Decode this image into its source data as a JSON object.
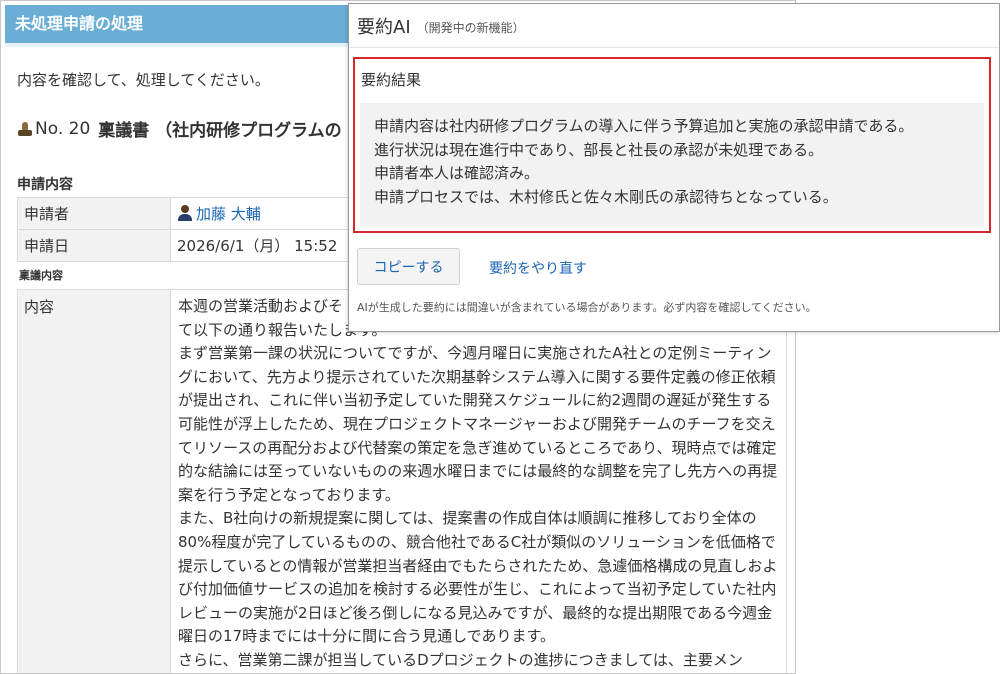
{
  "main": {
    "header_title": "未処理申請の処理",
    "instruction": "内容を確認して、処理してください。",
    "request_number": "No. 20",
    "request_doc": "稟議書 （社内研修プログラムの",
    "section_title": "申請内容",
    "fields": [
      {
        "label": "申請者",
        "value": "加藤 大輔"
      },
      {
        "label": "申請日",
        "value": "2026/6/1（月） 15:52"
      }
    ],
    "ringi_label": "稟議内容",
    "content_label": "内容",
    "content_text": "本週の営業活動およびそ\nて以下の通り報告いたします。\nまず営業第一課の状況についてですが、今週月曜日に実施されたA社との定例ミーティングにおいて、先方より提示されていた次期基幹システム導入に関する要件定義の修正依頼が提出され、これに伴い当初予定していた開発スケジュールに約2週間の遅延が発生する可能性が浮上したため、現在プロジェクトマネージャーおよび開発チームのチーフを交えてリソースの再配分および代替案の策定を急ぎ進めているところであり、現時点では確定的な結論には至っていないものの来週水曜日までには最終的な調整を完了し先方への再提案を行う予定となっております。\nまた、B社向けの新規提案に関しては、提案書の作成自体は順調に推移しており全体の80%程度が完了しているものの、競合他社であるC社が類似のソリューションを低価格で提示しているとの情報が営業担当者経由でもたらされたため、急遽価格構成の見直しおよび付加価値サービスの追加を検討する必要性が生じ、これによって当初予定していた社内レビューの実施が2日ほど後ろ倒しになる見込みですが、最終的な提出期限である今週金曜日の17時までには十分に間に合う見通しであります。\nさらに、営業第二課が担当しているDプロジェクトの進捗につきましては、主要メン"
  },
  "ai": {
    "title": "要約AI",
    "subtitle": "（開発中の新機能）",
    "result_label": "要約結果",
    "result_lines": [
      "申請内容は社内研修プログラムの導入に伴う予算追加と実施の承認申請である。",
      "進行状況は現在進行中であり、部長と社長の承認が未処理である。",
      "申請者本人は確認済み。",
      "申請プロセスでは、木村修氏と佐々木剛氏の承認待ちとなっている。"
    ],
    "copy_label": "コピーする",
    "redo_label": "要約をやり直す",
    "disclaimer": "AIが生成した要約には間違いが含まれている場合があります。必ず内容を確認してください。"
  },
  "colors": {
    "header_bg": "#6aaed6",
    "link": "#1a66b3",
    "highlight_border": "#d8282c"
  }
}
